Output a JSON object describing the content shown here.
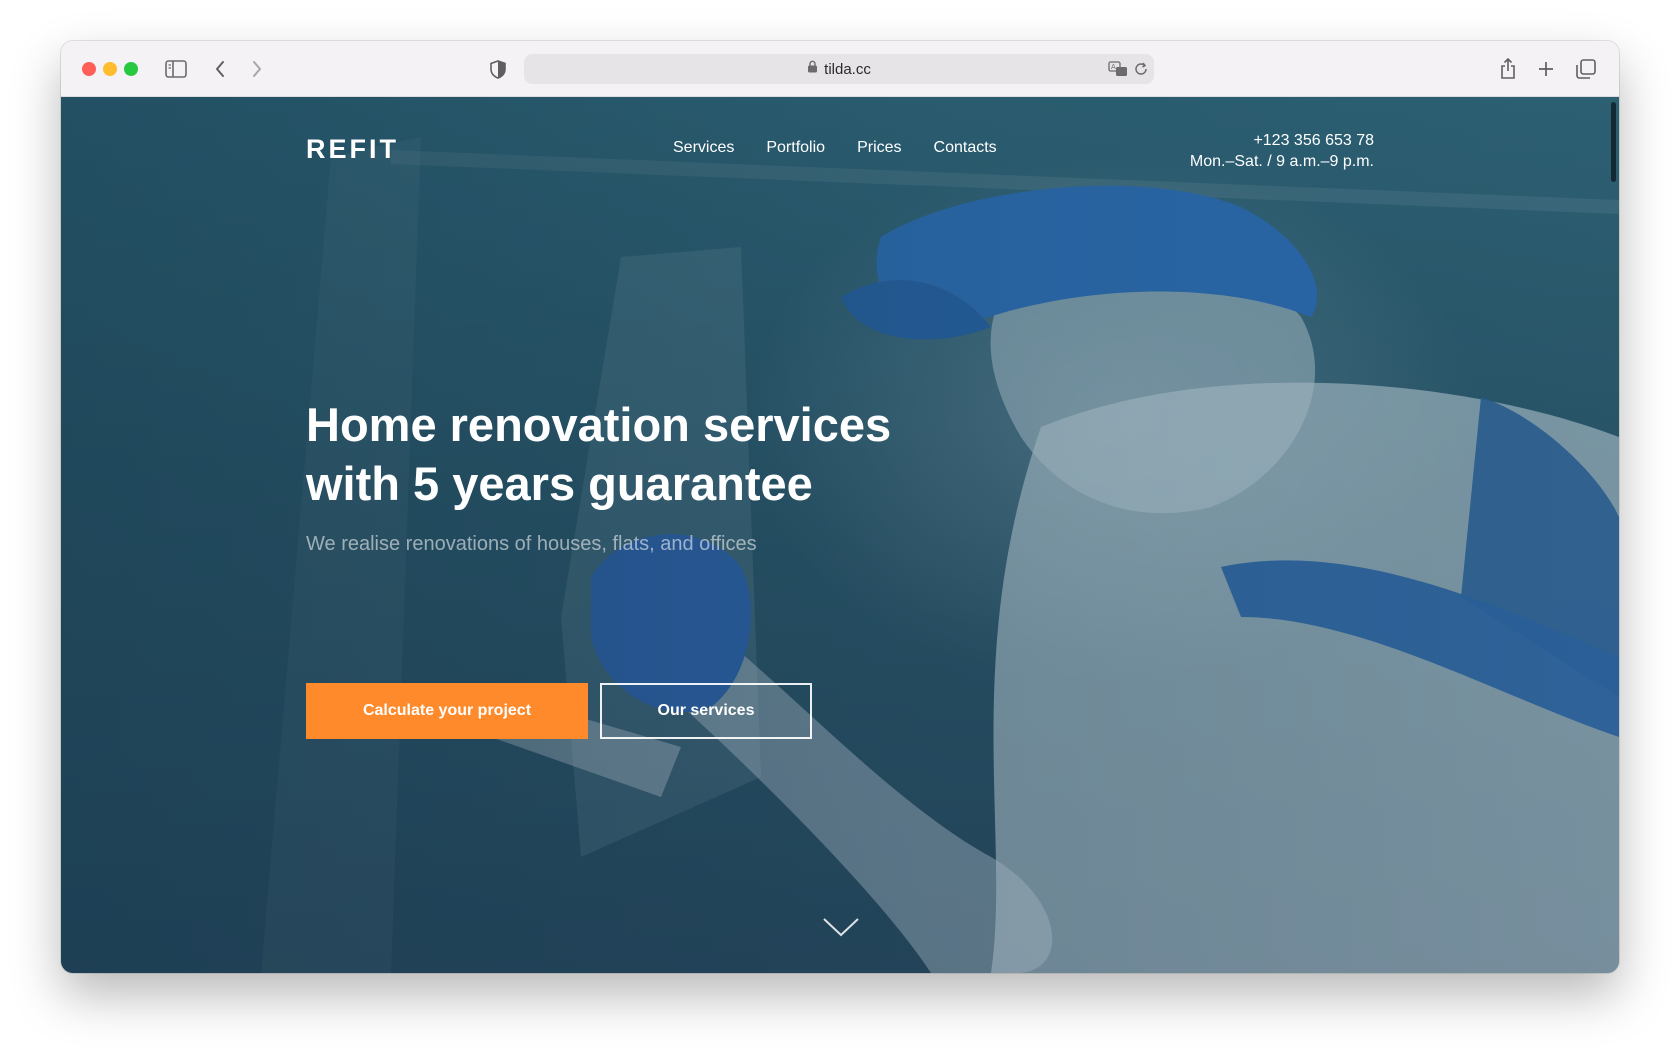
{
  "browser": {
    "url": "tilda.cc",
    "icons": {
      "sidebar": "sidebar-icon",
      "back": "chevron-left-icon",
      "forward": "chevron-right-icon",
      "privacy": "shield-icon",
      "lock": "lock-icon",
      "translate": "translate-icon",
      "reload": "reload-icon",
      "share": "share-icon",
      "new_tab": "plus-icon",
      "tabs": "tabs-icon"
    }
  },
  "site": {
    "logo": "REFIT",
    "nav": [
      "Services",
      "Portfolio",
      "Prices",
      "Contacts"
    ],
    "phone": "+123 356 653 78",
    "hours": "Mon.–Sat. / 9 a.m.–9 p.m.",
    "headline_line1": "Home renovation services",
    "headline_line2": "with 5 years guarantee",
    "subtitle": "We realise renovations of houses, flats, and offices",
    "cta_primary": "Calculate your project",
    "cta_secondary": "Our services"
  },
  "colors": {
    "accent": "#ff8a2b",
    "hero_tint": "#2a5568"
  }
}
